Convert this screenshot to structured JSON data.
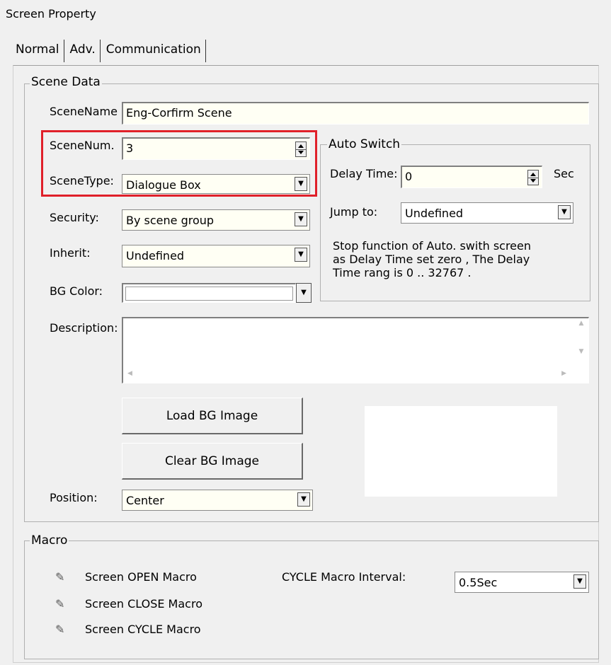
{
  "window": {
    "title": "Screen Property"
  },
  "tabs": [
    {
      "label": "Normal"
    },
    {
      "label": "Adv."
    },
    {
      "label": "Communication"
    }
  ],
  "scene_data": {
    "legend": "Scene Data",
    "scene_name": {
      "label": "SceneName",
      "value": "Eng-Corfirm Scene"
    },
    "scene_num": {
      "label": "SceneNum.",
      "value": "3"
    },
    "scene_type": {
      "label": "SceneType:",
      "value": "Dialogue Box"
    },
    "security": {
      "label": "Security:",
      "value": "By scene group"
    },
    "inherit": {
      "label": "Inherit:",
      "value": "Undefined"
    },
    "bg_color": {
      "label": "BG Color:",
      "value": ""
    },
    "description": {
      "label": "Description:",
      "value": ""
    },
    "load_bg_label": "Load BG Image",
    "clear_bg_label": "Clear BG Image",
    "position": {
      "label": "Position:",
      "value": "Center"
    }
  },
  "auto_switch": {
    "legend": "Auto Switch",
    "delay_time": {
      "label": "Delay Time:",
      "value": "0",
      "unit": "Sec"
    },
    "jump_to": {
      "label": "Jump to:",
      "value": "Undefined"
    },
    "note_line1": "Stop function of Auto. swith screen",
    "note_line2": "as Delay Time set zero , The Delay",
    "note_line3": "Time rang is 0 .. 32767 ."
  },
  "macro": {
    "legend": "Macro",
    "items": [
      {
        "label": "Screen OPEN Macro"
      },
      {
        "label": "Screen CLOSE Macro"
      },
      {
        "label": "Screen CYCLE Macro"
      }
    ],
    "cycle_interval": {
      "label": "CYCLE Macro Interval:",
      "value": "0.5Sec"
    }
  },
  "icons": {
    "dropdown": "chevron-down-icon",
    "spinner": "spinner-arrows-icon",
    "macro": "macro-pen-icon"
  },
  "colors": {
    "highlight": "#e0202a",
    "background": "#f0f0f0"
  }
}
